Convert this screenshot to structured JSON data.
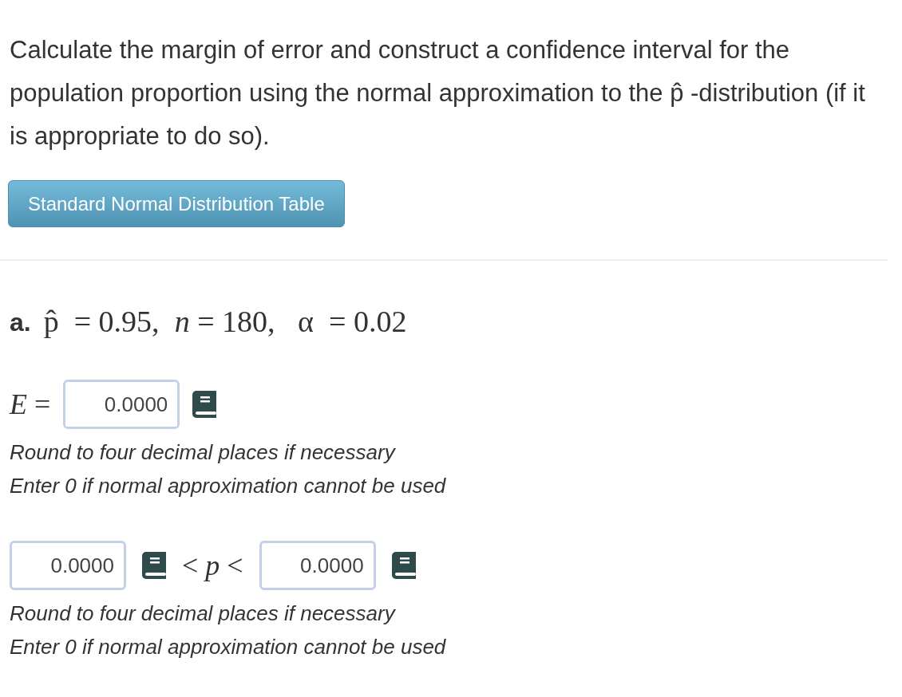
{
  "question": "Calculate the margin of error and construct a confidence interval for the population proportion using the normal approximation to the  p̂ -distribution (if it is appropriate to do so).",
  "table_button": "Standard Normal Distribution Table",
  "part": {
    "label": "a.",
    "given": "p̂  = 0.95,  *n* = 180,   α  = 0.02",
    "margin": {
      "symbol": "*E* =",
      "field": {
        "value": "0.0000"
      },
      "hints": [
        "Round to four decimal places if necessary",
        "Enter 0 if normal approximation cannot be used"
      ]
    },
    "interval": {
      "lower": {
        "value": "0.0000"
      },
      "relation": "< *p* <",
      "upper": {
        "value": "0.0000"
      },
      "hints": [
        "Round to four decimal places if necessary",
        "Enter 0 if normal approximation cannot be used"
      ]
    }
  }
}
